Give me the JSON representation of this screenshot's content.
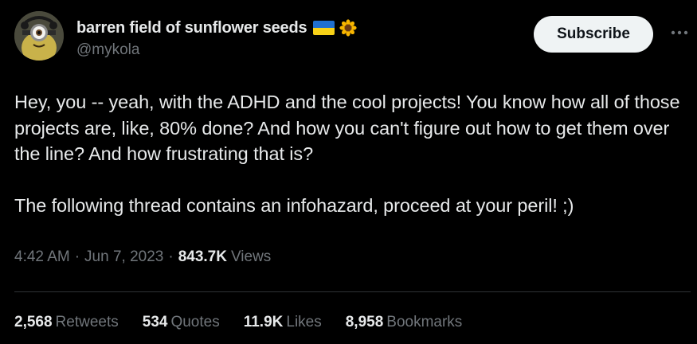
{
  "author": {
    "display_name": "barren field of sunflower seeds",
    "flag_icon": "ukraine-flag-icon",
    "emoji_icon": "sunflower-icon",
    "handle": "@mykola"
  },
  "actions": {
    "subscribe_label": "Subscribe",
    "more_icon": "more-horizontal-icon"
  },
  "tweet": {
    "text": "Hey, you -- yeah, with the ADHD and the cool projects! You know how all of those projects are, like, 80% done? And how you can't figure out how to get them over the line? And how frustrating that is?\n\nThe following thread contains an infohazard, proceed at your peril! ;)",
    "time": "4:42 AM",
    "date": "Jun 7, 2023",
    "views_count": "843.7K",
    "views_label": "Views",
    "separator": "·"
  },
  "stats": [
    {
      "count": "2,568",
      "label": "Retweets"
    },
    {
      "count": "534",
      "label": "Quotes"
    },
    {
      "count": "11.9K",
      "label": "Likes"
    },
    {
      "count": "8,958",
      "label": "Bookmarks"
    }
  ],
  "colors": {
    "background": "#000000",
    "text": "#e7e9ea",
    "secondary": "#71767b",
    "border": "#2f3336",
    "button_bg": "#eff3f4"
  }
}
